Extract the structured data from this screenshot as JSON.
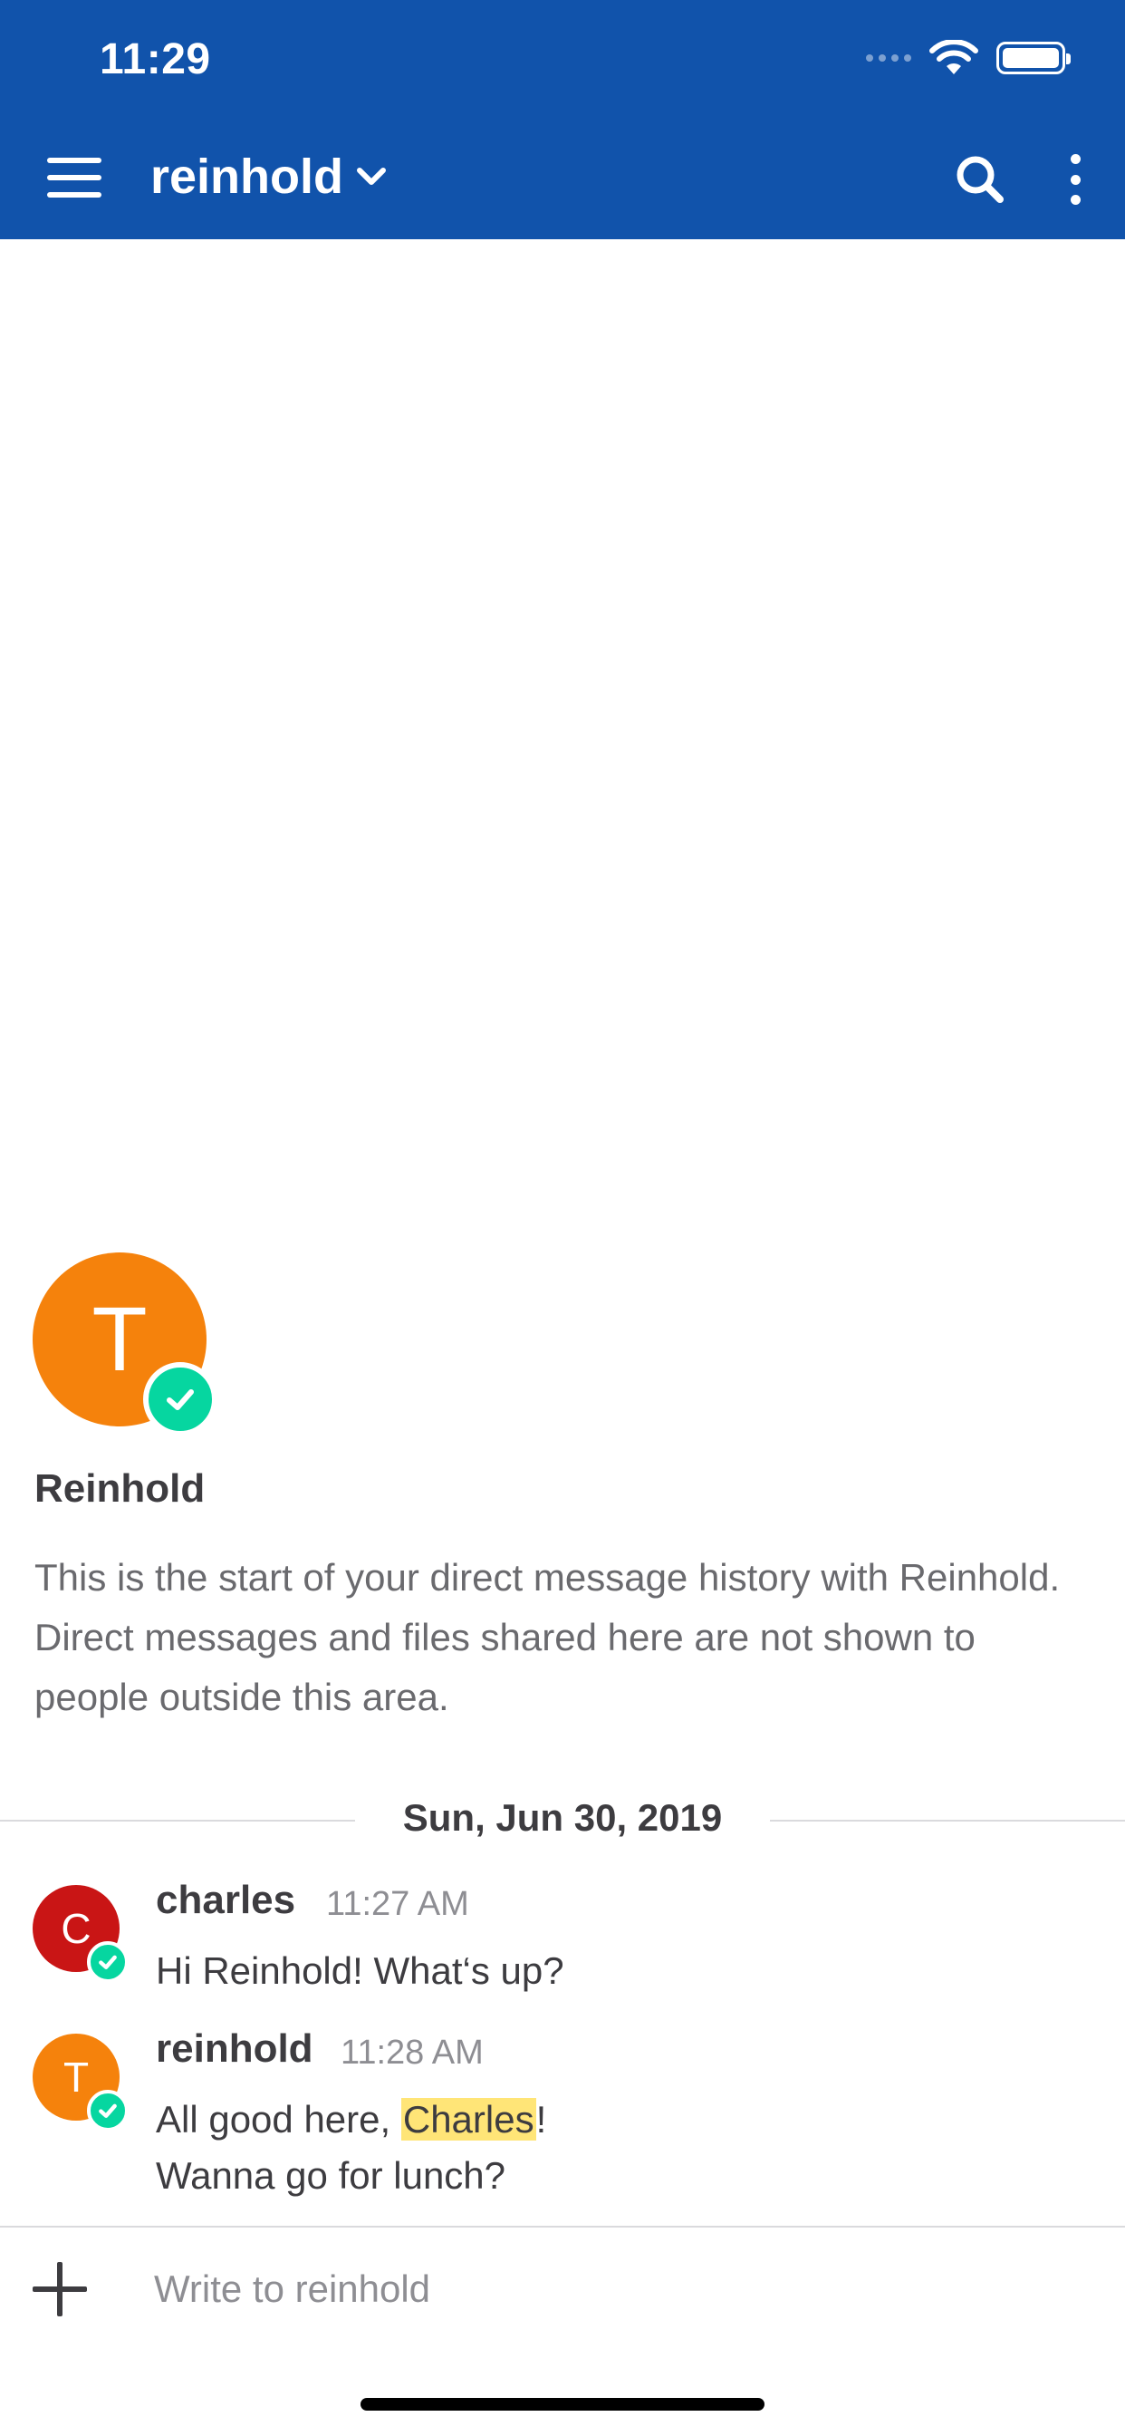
{
  "status_bar": {
    "time": "11:29"
  },
  "header": {
    "channel_name": "reinhold"
  },
  "intro": {
    "avatar_initial": "T",
    "name": "Reinhold",
    "text": "This is the start of your direct message history with Reinhold. Direct messages and files shared here are not shown to people outside this area."
  },
  "date_separator": "Sun, Jun 30, 2019",
  "posts": [
    {
      "author": "charles",
      "time": "11:27 AM",
      "avatar_initial": "C",
      "avatar_color": "#c91515",
      "message": "Hi Reinhold! What‘s up?"
    },
    {
      "author": "reinhold",
      "time": "11:28 AM",
      "avatar_initial": "T",
      "avatar_color": "#f5820c",
      "message_before": "All good here, ",
      "mention": "Charles",
      "message_after": "!",
      "message_line2": "Wanna go for lunch?"
    }
  ],
  "composer": {
    "placeholder": "Write to reinhold"
  },
  "colors": {
    "header_bg": "#1153ab",
    "online_status": "#06d6a0",
    "mention_highlight": "#ffe577"
  },
  "icons": {
    "menu": "hamburger-icon",
    "dropdown": "chevron-down-icon",
    "search": "search-icon",
    "more": "kebab-icon",
    "status": "check-icon",
    "attach": "plus-icon"
  }
}
